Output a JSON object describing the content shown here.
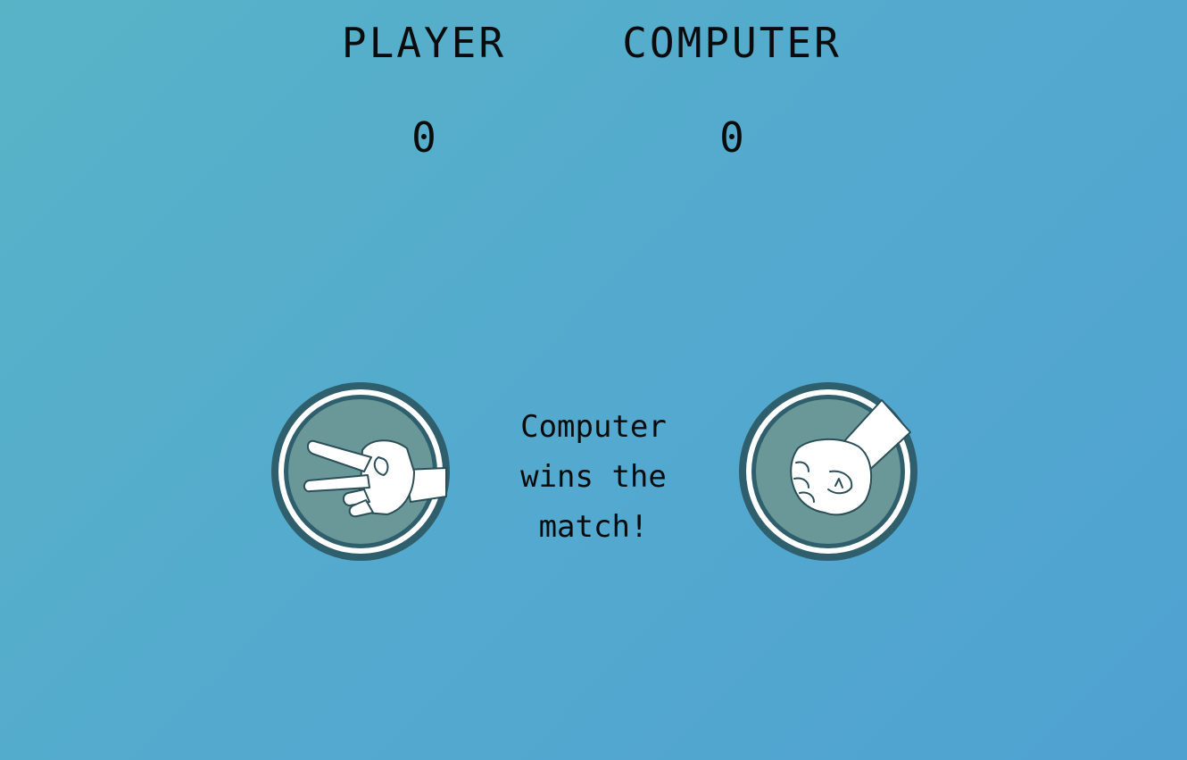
{
  "scoreboard": {
    "player_label": "PLAYER",
    "computer_label": "COMPUTER",
    "player_score": "0",
    "computer_score": "0"
  },
  "round": {
    "player_choice_icon": "scissors-hand-icon",
    "computer_choice_icon": "rock-fist-icon",
    "result_message": "Computer wins the match!"
  },
  "colors": {
    "background_start": "#58b3c7",
    "background_end": "#4fa2d0",
    "badge_outer": "#2f5f6c",
    "badge_ring": "#ffffff",
    "badge_fill": "#6a9798",
    "text": "#0b0b0b"
  }
}
